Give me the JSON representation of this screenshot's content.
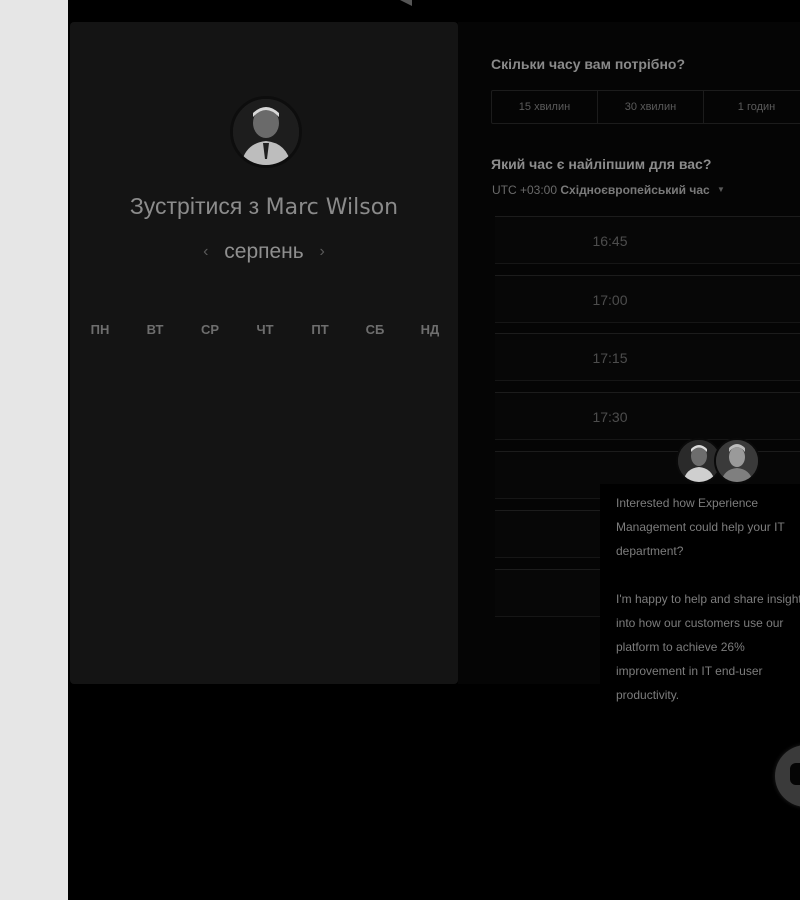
{
  "meeting": {
    "prefix": "Зустрітися з",
    "host": "Marc Wilson"
  },
  "calendar": {
    "month": "серпень",
    "prev_icon": "‹",
    "next_icon": "›",
    "weekdays": [
      "ПН",
      "ВТ",
      "СР",
      "ЧТ",
      "ПТ",
      "СБ",
      "НД"
    ]
  },
  "duration": {
    "question": "Скільки часу вам потрібно?",
    "options": [
      "15 хвилин",
      "30 хвилин",
      "1 годин"
    ]
  },
  "time": {
    "question": "Який час є найліпшим для вас?",
    "tz_offset": "UTC +03:00",
    "tz_name": "Східноєвропейський час",
    "slots": [
      "16:45",
      "17:00",
      "17:15",
      "17:30",
      "",
      "",
      ""
    ]
  },
  "chat": {
    "paragraph_1": "Interested how Experience Management could help your IT department?",
    "paragraph_2": "I'm happy to help and share insight into how our customers use our platform to achieve 26% improvement in IT end-user productivity."
  },
  "icons": {
    "prev": "chevron-left-icon",
    "next": "chevron-right-icon",
    "timezone_caret": "caret-down-icon",
    "chat_launcher": "chat-icon"
  }
}
